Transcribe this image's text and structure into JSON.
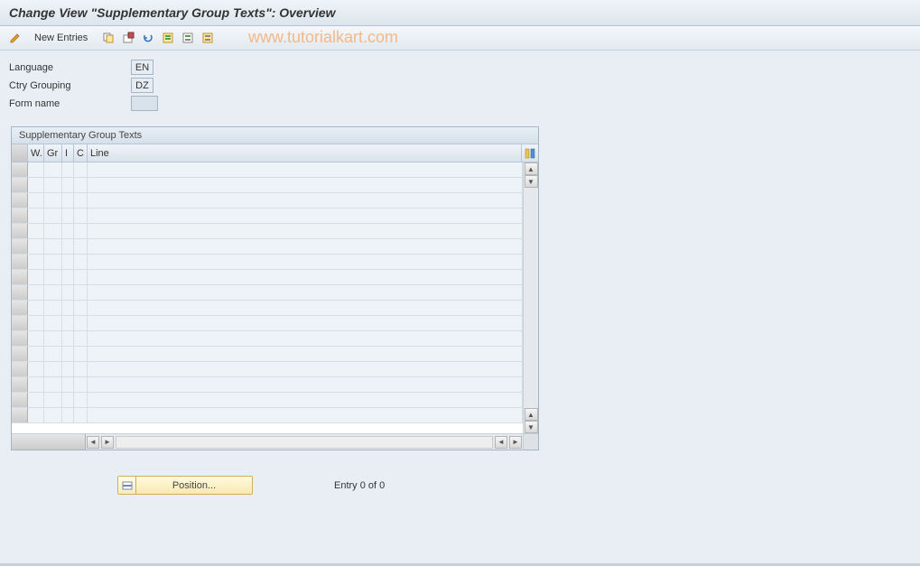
{
  "title": "Change View \"Supplementary Group Texts\": Overview",
  "toolbar": {
    "new_entries": "New Entries"
  },
  "watermark": "www.tutorialkart.com",
  "form": {
    "language_label": "Language",
    "language_value": "EN",
    "ctry_label": "Ctry Grouping",
    "ctry_value": "DZ",
    "form_name_label": "Form name",
    "form_name_value": ""
  },
  "grid": {
    "title": "Supplementary Group Texts",
    "columns": {
      "w": "W.",
      "gr": "Gr",
      "i": "I",
      "c": "C",
      "line": "Line"
    },
    "rows": []
  },
  "footer": {
    "position_label": "Position...",
    "entry_text": "Entry 0 of 0"
  }
}
